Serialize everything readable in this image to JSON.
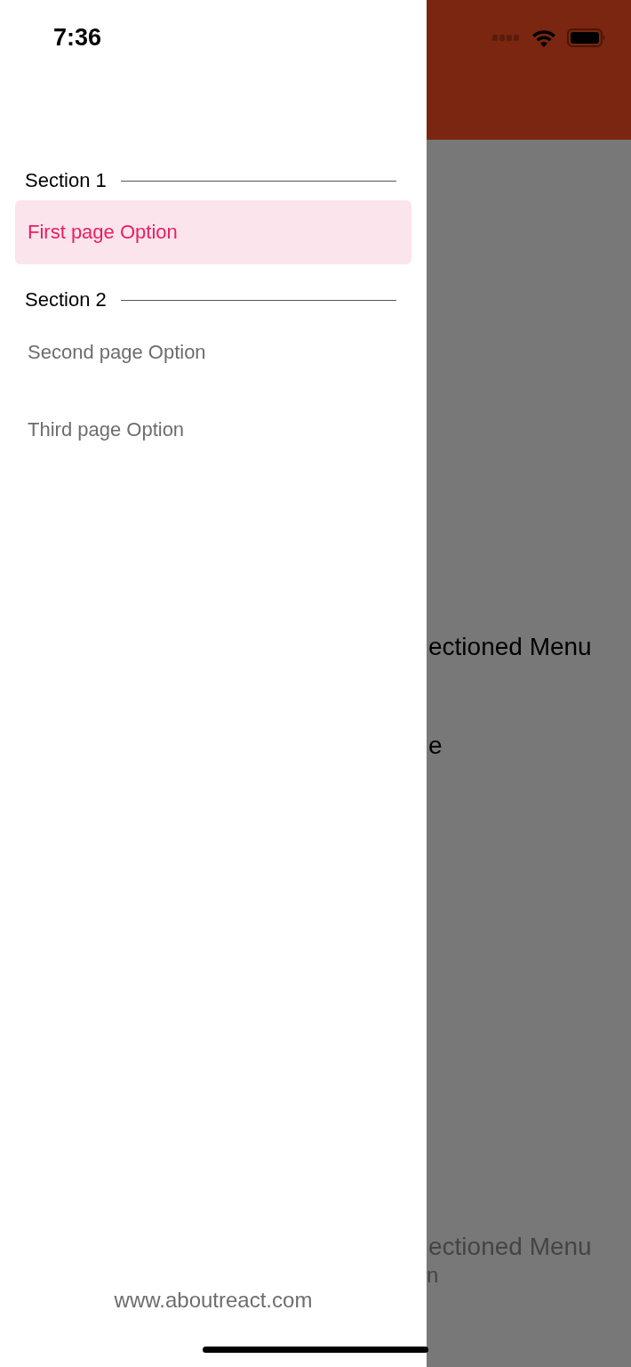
{
  "status_bar": {
    "time": "7:36"
  },
  "drawer": {
    "sections": [
      {
        "title": "Section 1",
        "items": [
          {
            "label": "First page Option",
            "selected": true
          }
        ]
      },
      {
        "title": "Section 2",
        "items": [
          {
            "label": "Second page Option",
            "selected": false
          },
          {
            "label": "Third page Option",
            "selected": false
          }
        ]
      }
    ],
    "footer": "www.aboutreact.com"
  },
  "background_screen": {
    "texts": [
      "ectioned Menu",
      "e"
    ],
    "bottom_texts": [
      "ectioned Menu",
      "n"
    ]
  }
}
